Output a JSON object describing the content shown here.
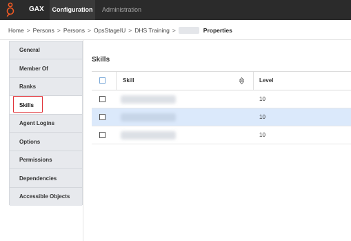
{
  "topbar": {
    "app_name": "GAX",
    "tabs": [
      {
        "label": "Configuration",
        "active": true
      },
      {
        "label": "Administration",
        "active": false
      }
    ],
    "logo_color": "#f15a24"
  },
  "breadcrumb": {
    "items": [
      "Home",
      "Persons",
      "Persons",
      "OpsStageIU",
      "DHS Training"
    ],
    "separator": ">",
    "current": "Properties"
  },
  "sidebar": {
    "items": [
      {
        "label": "General"
      },
      {
        "label": "Member Of"
      },
      {
        "label": "Ranks"
      },
      {
        "label": "Skills",
        "active": true
      },
      {
        "label": "Agent Logins"
      },
      {
        "label": "Options"
      },
      {
        "label": "Permissions"
      },
      {
        "label": "Dependencies"
      },
      {
        "label": "Accessible Objects"
      }
    ],
    "highlight_color": "#e0343a"
  },
  "main": {
    "title": "Skills",
    "table": {
      "columns": [
        "Skill",
        "Level"
      ],
      "rows": [
        {
          "level": "10",
          "selected": false
        },
        {
          "level": "10",
          "selected": true
        },
        {
          "level": "10",
          "selected": false
        }
      ],
      "selected_row_color": "#dbe9fb"
    }
  }
}
